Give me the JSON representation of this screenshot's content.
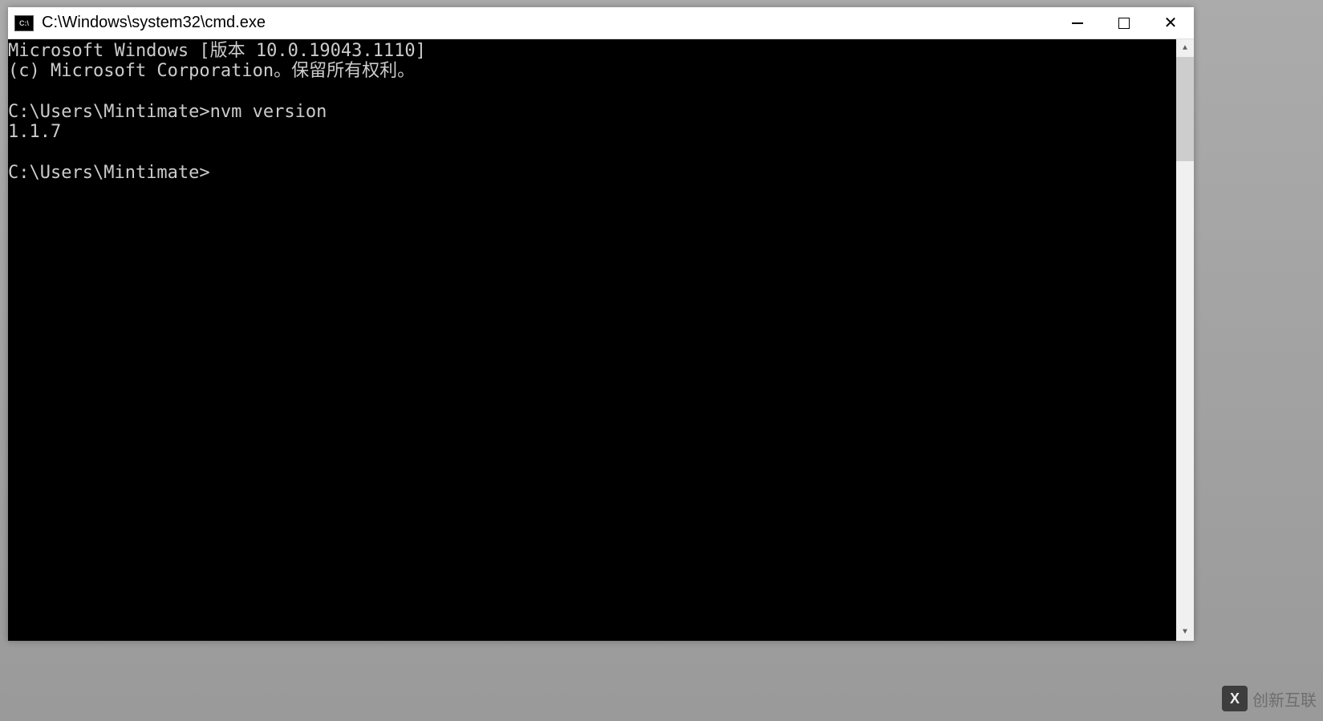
{
  "window": {
    "title": "C:\\Windows\\system32\\cmd.exe",
    "icon_label": "C:\\"
  },
  "terminal": {
    "lines": [
      "Microsoft Windows [版本 10.0.19043.1110]",
      "(c) Microsoft Corporation。保留所有权利。",
      "",
      "C:\\Users\\Mintimate>nvm version",
      "1.1.7",
      "",
      "C:\\Users\\Mintimate>"
    ]
  },
  "watermark": {
    "logo_text": "X",
    "brand": "创新互联"
  }
}
